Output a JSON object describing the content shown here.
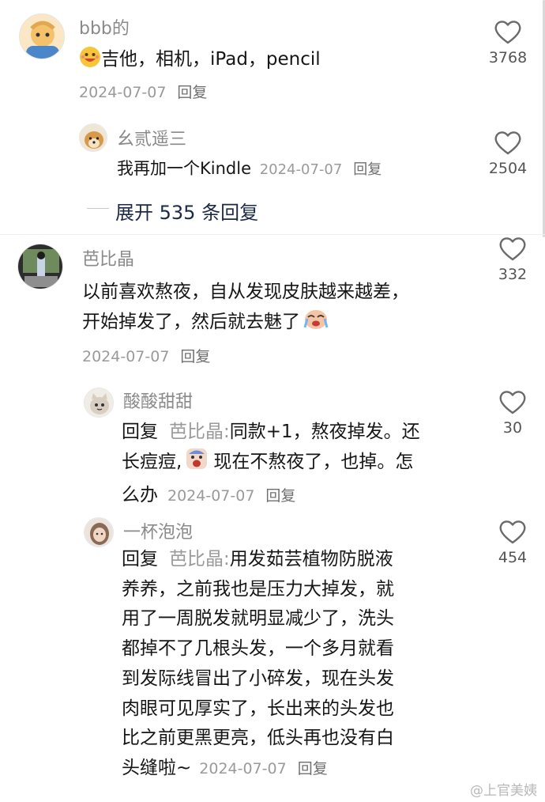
{
  "comments": [
    {
      "username": "bbb的",
      "text": "吉他，相机，iPad，pencil",
      "date": "2024-07-07",
      "reply_label": "回复",
      "likes": "3768"
    },
    {
      "username": "幺贰遥三",
      "text": "我再加一个Kindle",
      "date": "2024-07-07",
      "reply_label": "回复",
      "likes": "2504"
    },
    {
      "username": "芭比晶",
      "text_line1": "以前喜欢熬夜，自从发现皮肤越来越差，",
      "text_line2": "开始掉发了，然后就去魅了",
      "date": "2024-07-07",
      "reply_label": "回复",
      "likes": "332"
    },
    {
      "username": "酸酸甜甜",
      "reply_prefix": "回复",
      "mention": "芭比晶:",
      "text_line1": "同款+1，熬夜掉发。还",
      "text_line2a": "长痘痘,",
      "text_line2b": "现在不熬夜了，也掉。怎",
      "text_line3": "么办",
      "date": "2024-07-07",
      "reply_label": "回复",
      "likes": "30"
    },
    {
      "username": "一杯泡泡",
      "reply_prefix": "回复",
      "mention": "芭比晶:",
      "text_line1": "用发茹芸植物防脱液",
      "text_line2": "养养，之前我也是压力大掉发，就",
      "text_line3": "用了一周脱发就明显减少了，洗头",
      "text_line4": "都掉不了几根头发，一个多月就看",
      "text_line5": "到发际线冒出了小碎发，现在头发",
      "text_line6": "肉眼可见厚实了，长出来的头发也",
      "text_line7": "比之前更黑更亮，低头再也没有白",
      "text_line8": "头缝啦~",
      "date": "2024-07-07",
      "reply_label": "回复",
      "likes": "454"
    }
  ],
  "expand_replies": "展开 535 条回复",
  "watermark": "@上官美姨",
  "icons": {
    "like": "heart-outline-icon",
    "emoji_laugh": "grinning-face-emoji",
    "emoji_cry": "loudly-crying-face-emoji",
    "emoji_scream": "angry-scream-emoji"
  },
  "colors": {
    "text": "#161616",
    "meta": "#9a9a9a",
    "username": "#8a8a8a",
    "expand": "#1b2a44"
  }
}
